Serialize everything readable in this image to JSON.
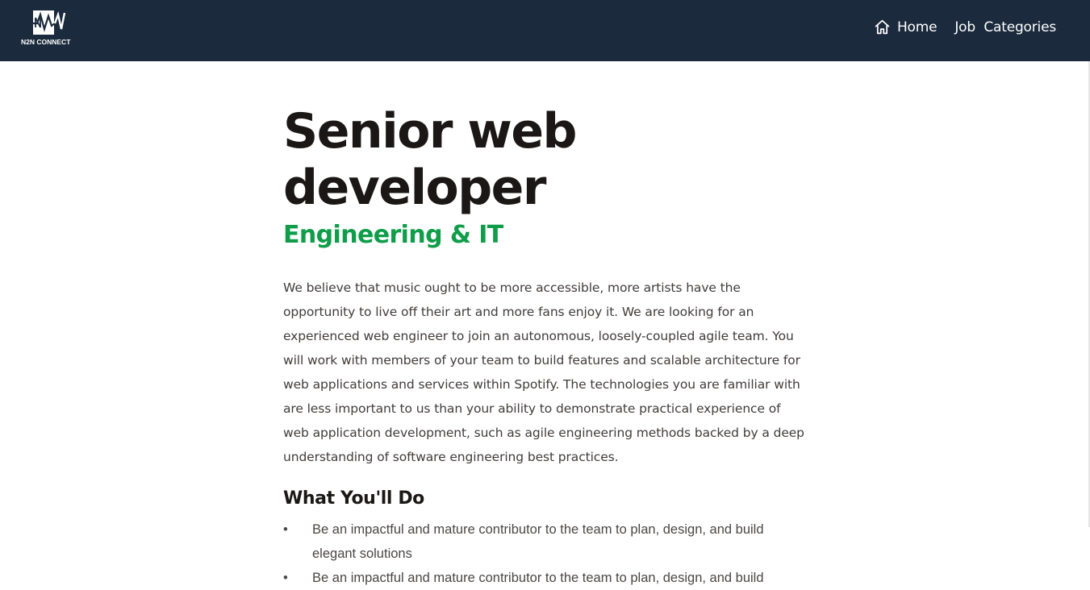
{
  "brand": {
    "name": "N2N CONNECT",
    "mark": "N2N"
  },
  "nav": {
    "home_label": "Home",
    "home_icon": "home-icon",
    "categories_label": "Job  Categories"
  },
  "colors": {
    "header_bg": "#1b2a3d",
    "category_green": "#0f9d49",
    "title_text": "#1a1716",
    "body_text": "#403c3a"
  },
  "job": {
    "title": "Senior web developer",
    "category": "Engineering & IT",
    "description": "We believe that music ought to be more accessible, more artists have the opportunity to live off their art and more fans enjoy it. We are looking for an experienced web engineer to join an autonomous, loosely-coupled agile team. You will work with members of your team to build features and scalable architecture for web applications and services within Spotify. The technologies you are familiar with are less important to us than your ability to demonstrate practical experience of web application development, such as agile engineering methods backed by a deep understanding of software engineering best practices.",
    "section_heading": "What You'll Do",
    "duties": [
      "Be an impactful and mature contributor to the team to plan, design, and build elegant solutions",
      "Be an impactful and mature contributor to the team to plan, design, and build"
    ]
  }
}
